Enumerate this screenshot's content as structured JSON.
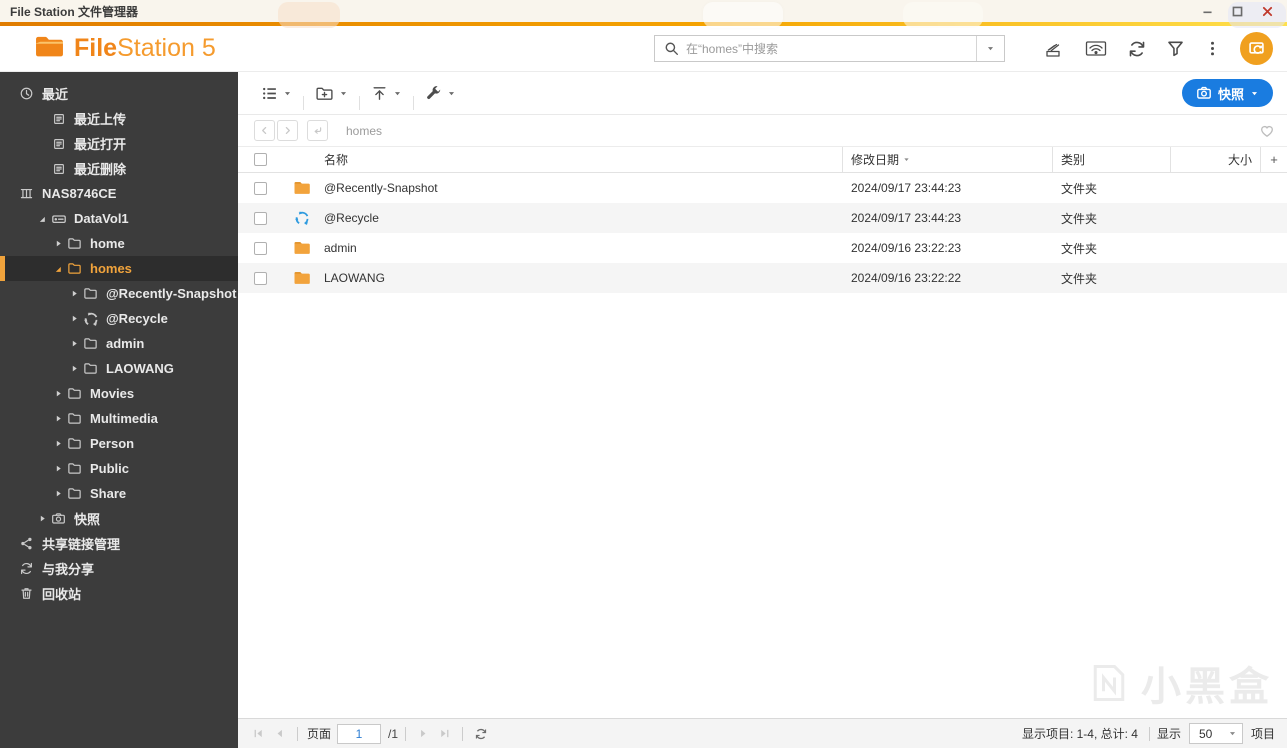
{
  "window": {
    "title": "File Station 文件管理器",
    "controls": {
      "minimize": "minimize",
      "maximize": "maximize",
      "close": "close"
    }
  },
  "app_header": {
    "logo_bold": "File",
    "logo_rest": "Station 5",
    "search": {
      "placeholder": "在“homes”中搜索"
    },
    "action_icons": [
      {
        "name": "external-device-icon"
      },
      {
        "name": "remote-connection-icon"
      },
      {
        "name": "refresh-icon"
      },
      {
        "name": "filter-icon"
      },
      {
        "name": "more-options-icon"
      }
    ]
  },
  "toolbar": {
    "groups": [
      {
        "name": "view-mode",
        "icon": "list-view"
      },
      {
        "name": "new-folder",
        "icon": "new-folder"
      },
      {
        "name": "upload",
        "icon": "upload"
      },
      {
        "name": "tools",
        "icon": "tools"
      }
    ],
    "snapshot_button": {
      "label": "快照"
    }
  },
  "breadcrumb": {
    "path": "homes"
  },
  "sidebar": {
    "items": [
      {
        "id": "recent",
        "label": "最近",
        "icon": "clock",
        "level": 0
      },
      {
        "id": "recent-uploaded",
        "label": "最近上传",
        "icon": "doc-list",
        "level": 1
      },
      {
        "id": "recent-opened",
        "label": "最近打开",
        "icon": "doc-list",
        "level": 1
      },
      {
        "id": "recent-deleted",
        "label": "最近删除",
        "icon": "doc-list",
        "level": 1
      },
      {
        "id": "nas8746ce",
        "label": "NAS8746CE",
        "icon": "nas",
        "level": 0
      },
      {
        "id": "datavol1",
        "label": "DataVol1",
        "icon": "drive",
        "level": 1,
        "expander": "expanded"
      },
      {
        "id": "home",
        "label": "home",
        "icon": "folder",
        "level": 2,
        "expander": "collapsed"
      },
      {
        "id": "homes",
        "label": "homes",
        "icon": "folder",
        "level": 2,
        "expander": "expanded",
        "selected": true
      },
      {
        "id": "recently-snapshot",
        "label": "@Recently-Snapshot",
        "icon": "folder",
        "level": 3,
        "expander": "collapsed"
      },
      {
        "id": "recycle",
        "label": "@Recycle",
        "icon": "recycle",
        "level": 3,
        "expander": "collapsed"
      },
      {
        "id": "admin",
        "label": "admin",
        "icon": "folder",
        "level": 3,
        "expander": "collapsed"
      },
      {
        "id": "laowang",
        "label": "LAOWANG",
        "icon": "folder",
        "level": 3,
        "expander": "collapsed"
      },
      {
        "id": "movies",
        "label": "Movies",
        "icon": "folder",
        "level": 2,
        "expander": "collapsed"
      },
      {
        "id": "multimedia",
        "label": "Multimedia",
        "icon": "folder",
        "level": 2,
        "expander": "collapsed"
      },
      {
        "id": "person",
        "label": "Person",
        "icon": "folder",
        "level": 2,
        "expander": "collapsed"
      },
      {
        "id": "public",
        "label": "Public",
        "icon": "folder",
        "level": 2,
        "expander": "collapsed"
      },
      {
        "id": "share",
        "label": "Share",
        "icon": "folder",
        "level": 2,
        "expander": "collapsed"
      },
      {
        "id": "snapshot",
        "label": "快照",
        "icon": "camera",
        "level": 1,
        "expander": "collapsed"
      },
      {
        "id": "shared-links",
        "label": "共享链接管理",
        "icon": "share-link",
        "level": 0
      },
      {
        "id": "shared-with-me",
        "label": "与我分享",
        "icon": "sync",
        "level": 0
      },
      {
        "id": "recycle-bin",
        "label": "回收站",
        "icon": "trash",
        "level": 0
      }
    ]
  },
  "table": {
    "columns": {
      "name": "名称",
      "modified": "修改日期",
      "type": "类别",
      "size": "大小"
    },
    "sort_column": "修改日期",
    "sort_direction": "desc",
    "add_column_label": "+",
    "rows": [
      {
        "name": "@Recently-Snapshot",
        "icon": "folder",
        "modified": "2024/09/17 23:44:23",
        "type": "文件夹",
        "size": ""
      },
      {
        "name": "@Recycle",
        "icon": "recycle",
        "modified": "2024/09/17 23:44:23",
        "type": "文件夹",
        "size": ""
      },
      {
        "name": "admin",
        "icon": "folder",
        "modified": "2024/09/16 23:22:23",
        "type": "文件夹",
        "size": ""
      },
      {
        "name": "LAOWANG",
        "icon": "folder",
        "modified": "2024/09/16 23:22:22",
        "type": "文件夹",
        "size": ""
      }
    ]
  },
  "statusbar": {
    "page_label": "页面",
    "page_value": "1",
    "page_total": "/1",
    "items_summary": "显示项目:  1-4, 总计:  4",
    "show_label": "显示",
    "page_size": "50",
    "unit_label": "项目"
  },
  "watermark": {
    "text": "小黑盒"
  },
  "colors": {
    "accent_orange": "#f08519",
    "selected_orange": "#f0a33c",
    "snapshot_blue": "#1a7ce0",
    "recycle_blue": "#2f9bdf",
    "folder_yellow": "#f2a33c",
    "sidebar_bg": "#3c3c3c"
  }
}
